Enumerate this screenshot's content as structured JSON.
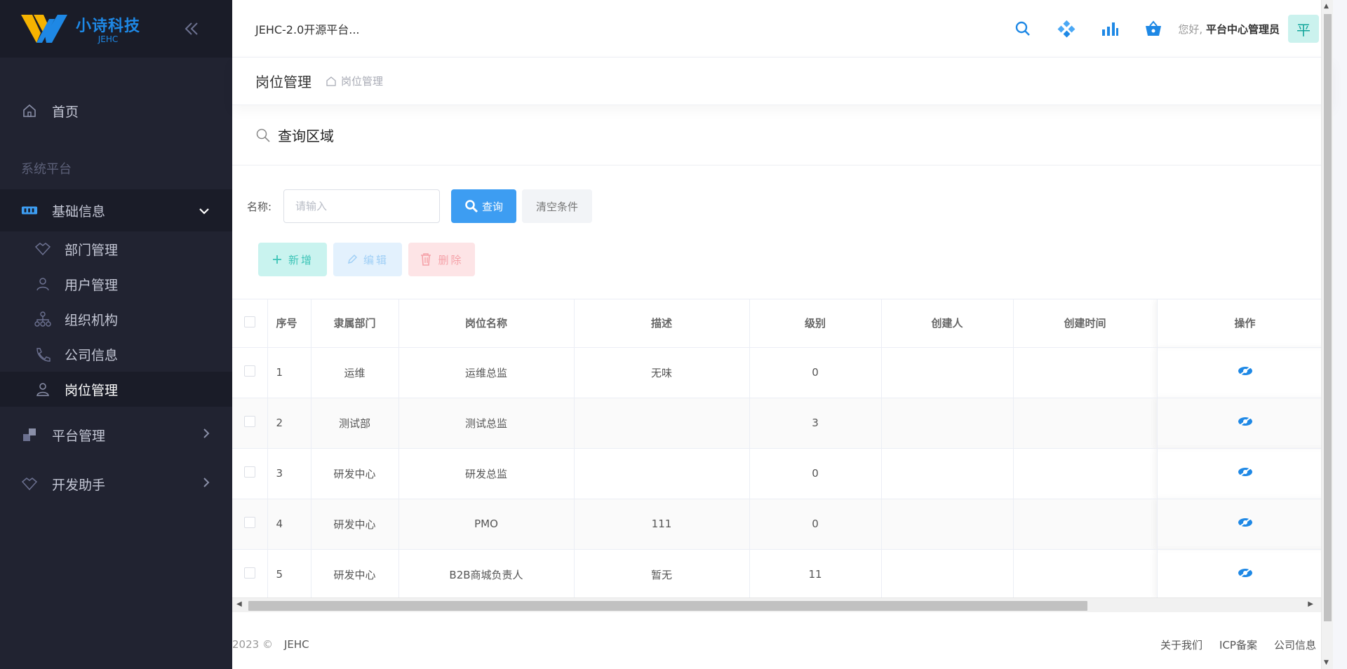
{
  "brand": {
    "name": "小诗科技",
    "sub": "JEHC"
  },
  "sidebar": {
    "home": "首页",
    "group_title": "系统平台",
    "basic": {
      "label": "基础信息",
      "items": [
        "部门管理",
        "用户管理",
        "组织机构",
        "公司信息",
        "岗位管理"
      ]
    },
    "platform": "平台管理",
    "dev": "开发助手"
  },
  "topbar": {
    "site_title": "JEHC-2.0开源平台...",
    "greet_prefix": "您好,",
    "user": "平台中心管理员",
    "avatar": "平"
  },
  "crumb": {
    "title": "岗位管理",
    "path": "岗位管理"
  },
  "query": {
    "title": "查询区域",
    "name_label": "名称:",
    "name_placeholder": "请输入",
    "query_btn": "查询",
    "clear_btn": "清空条件"
  },
  "actions": {
    "add": "新增",
    "edit": "编辑",
    "delete": "删除"
  },
  "table": {
    "headers": [
      "序号",
      "隶属部门",
      "岗位名称",
      "描述",
      "级别",
      "创建人",
      "创建时间",
      "操作"
    ],
    "rows": [
      {
        "no": "1",
        "dept": "运维",
        "name": "运维总监",
        "desc": "无味",
        "level": "0",
        "creator": "",
        "created": ""
      },
      {
        "no": "2",
        "dept": "测试部",
        "name": "测试总监",
        "desc": "",
        "level": "3",
        "creator": "",
        "created": ""
      },
      {
        "no": "3",
        "dept": "研发中心",
        "name": "研发总监",
        "desc": "",
        "level": "0",
        "creator": "",
        "created": ""
      },
      {
        "no": "4",
        "dept": "研发中心",
        "name": "PMO",
        "desc": "111",
        "level": "0",
        "creator": "",
        "created": ""
      },
      {
        "no": "5",
        "dept": "研发中心",
        "name": "B2B商城负责人",
        "desc": "暂无",
        "level": "11",
        "creator": "",
        "created": ""
      }
    ]
  },
  "footer": {
    "copy": "2023 ©",
    "brand": "JEHC",
    "links": [
      "关于我们",
      "ICP备案",
      "公司信息"
    ]
  },
  "colors": {
    "sidebar_bg": "#212331",
    "primary": "#3d9df2",
    "add": "#3cc4b7",
    "delete": "#f5a1a8"
  }
}
